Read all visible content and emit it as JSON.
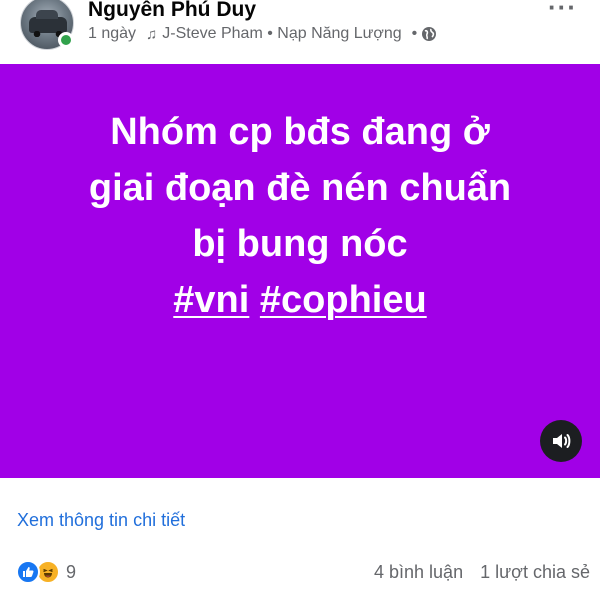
{
  "post": {
    "author": "Nguyễn Phú Duy",
    "time": "1 ngày",
    "song": "J-Steve Pham • Nạp Năng Lượng",
    "separator": "•",
    "text_lines": [
      "Nhóm cp bđs đang ở",
      "giai đoạn đè nén chuẩn",
      "bị bung nóc"
    ],
    "hashtags": [
      "#vni",
      "#cophieu"
    ],
    "background_color": "#a100e7",
    "details_link": "Xem thông tin chi tiết",
    "reaction_count": "9",
    "comments": "4 bình luận",
    "shares": "1 lượt chia sẻ"
  },
  "icons": {
    "music": "music-note-icon",
    "privacy": "globe-icon",
    "more": "more-options-icon",
    "sound": "speaker-icon",
    "reactions": [
      "like-icon",
      "haha-icon"
    ]
  },
  "colors": {
    "link": "#216fdb",
    "like": "#1877f2",
    "haha": "#f7b125",
    "online": "#31a24c"
  }
}
